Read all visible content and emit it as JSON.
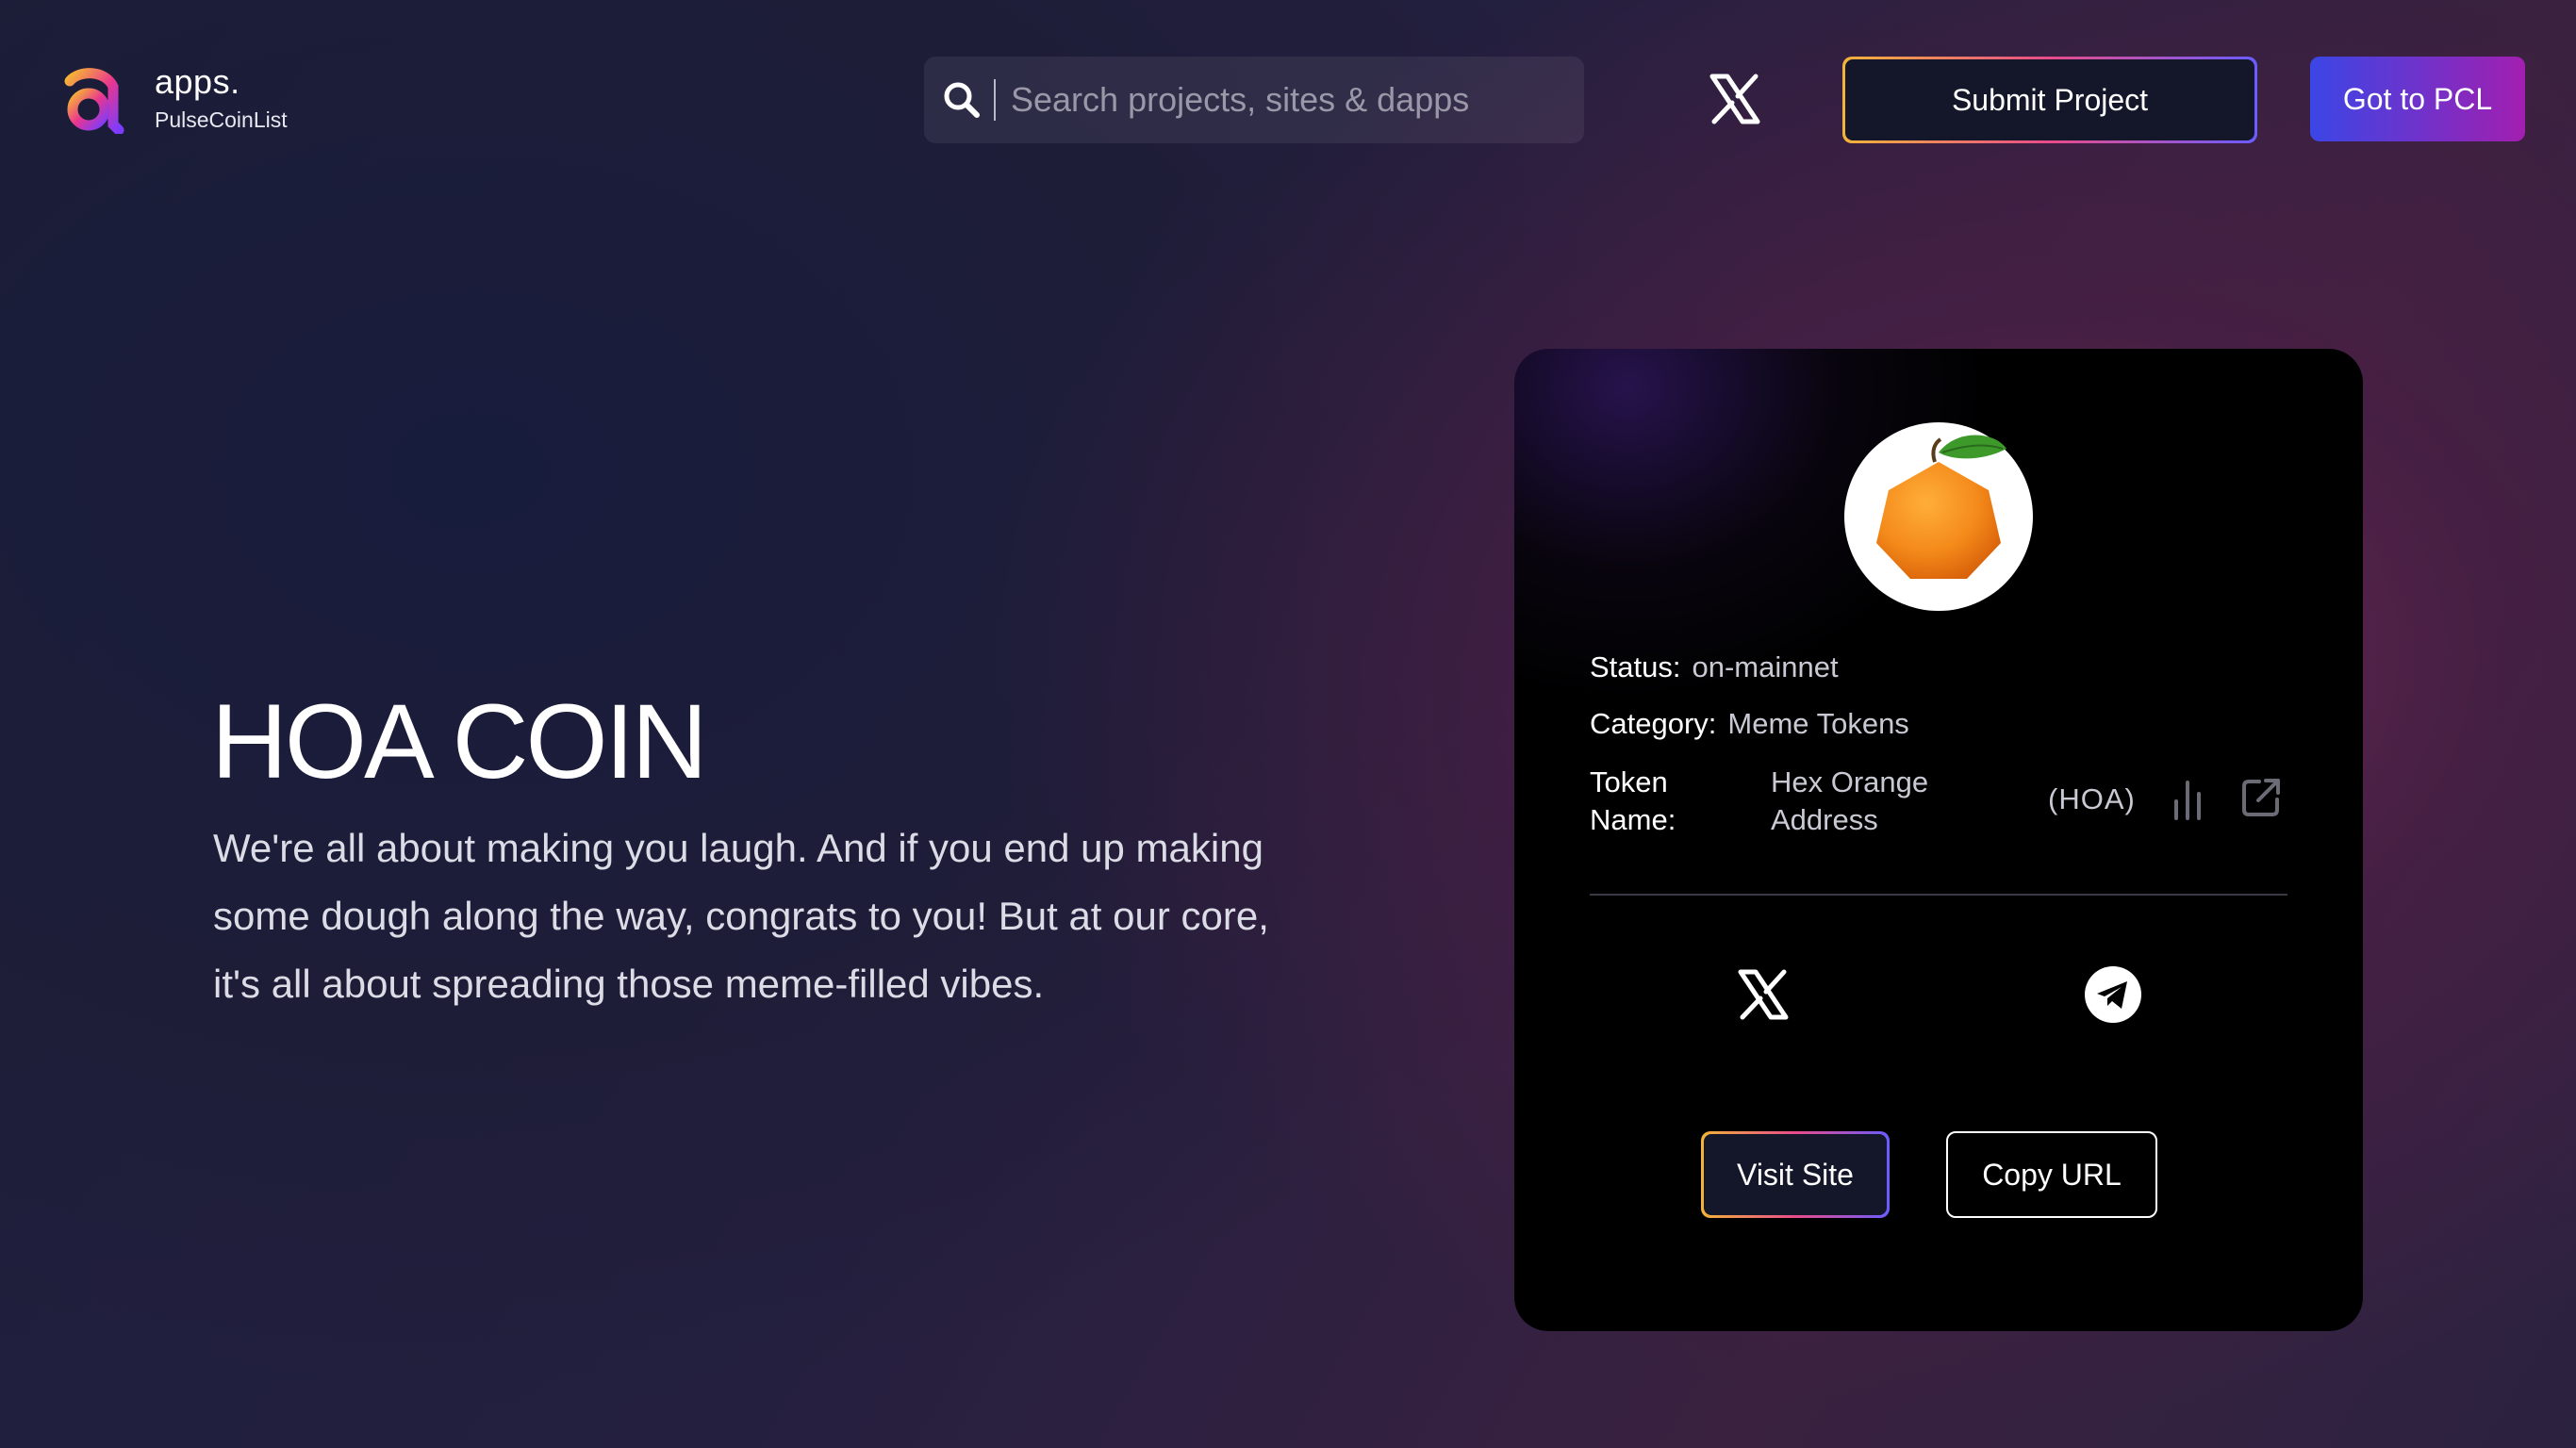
{
  "header": {
    "brand_name": "apps.",
    "brand_sub": "PulseCoinList",
    "search_placeholder": "Search projects, sites & dapps",
    "submit_label": "Submit Project",
    "pcl_label": "Got to PCL",
    "icons": [
      "apps-logo-icon",
      "search-icon",
      "x-icon"
    ]
  },
  "hero": {
    "title": "HOA COIN",
    "description": "We're all about making you laugh. And if you end up making some dough along the way, congrats to you! But at our core, it's all about spreading those meme-filled vibes."
  },
  "card": {
    "status_label": "Status:",
    "status_value": "on-mainnet",
    "category_label": "Category:",
    "category_value": "Meme Tokens",
    "token_label": "Token Name:",
    "token_name": "Hex Orange Address",
    "token_symbol": "(HOA)",
    "icons": [
      "orange-hexagon-logo",
      "bar-chart-icon",
      "external-link-icon",
      "x-icon",
      "telegram-icon"
    ],
    "visit_label": "Visit Site",
    "copy_label": "Copy URL"
  },
  "colors": {
    "accent_gradient_start": "#3b46e6",
    "accent_gradient_end": "#a21fb0",
    "border_gradient": [
      "#f3b43a",
      "#e84c8a",
      "#6a5cff"
    ],
    "card_bg": "#000000"
  }
}
